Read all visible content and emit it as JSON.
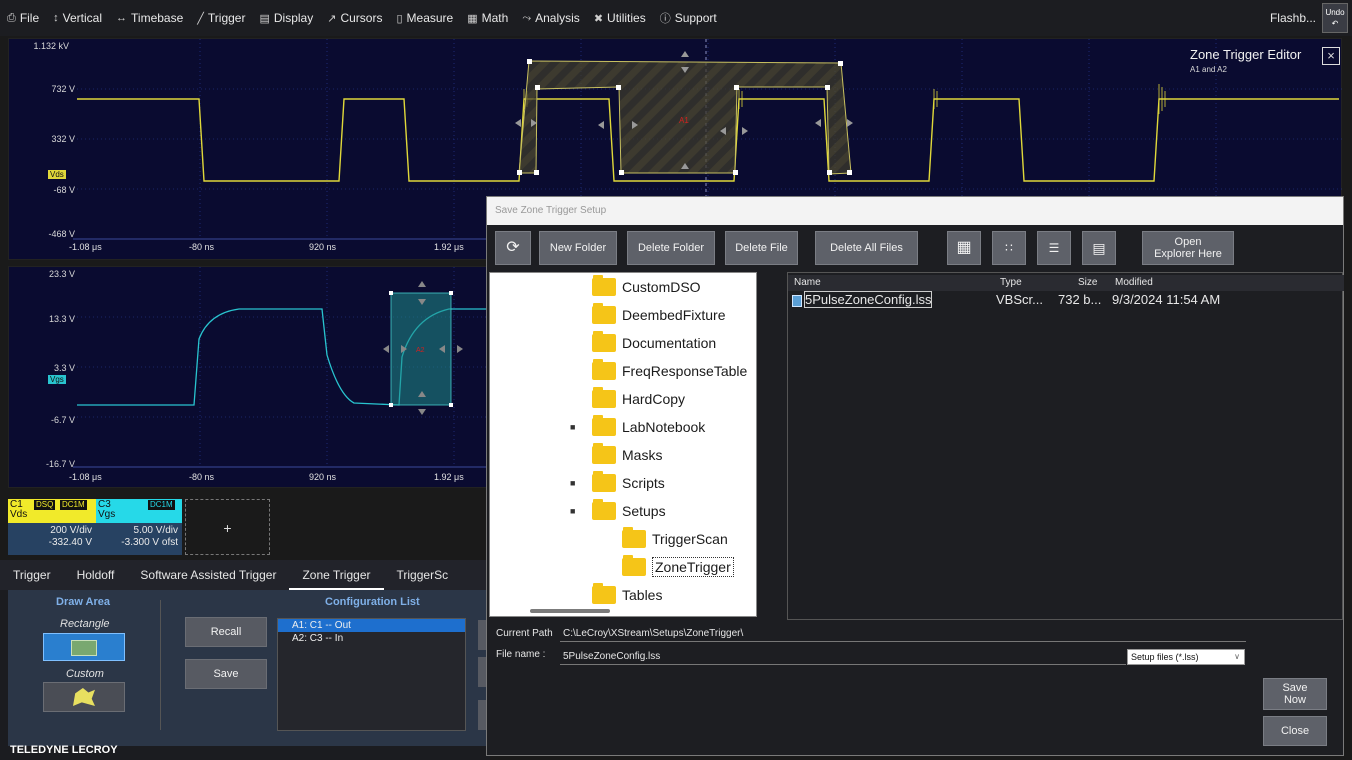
{
  "menu": {
    "items": [
      {
        "icon": "file-icon",
        "glyph": "⎙",
        "label": "File"
      },
      {
        "icon": "vertical-icon",
        "glyph": "↕",
        "label": "Vertical"
      },
      {
        "icon": "timebase-icon",
        "glyph": "↔",
        "label": "Timebase"
      },
      {
        "icon": "trigger-icon",
        "glyph": "╱",
        "label": "Trigger"
      },
      {
        "icon": "display-icon",
        "glyph": "▤",
        "label": "Display"
      },
      {
        "icon": "cursors-icon",
        "glyph": "↗",
        "label": "Cursors"
      },
      {
        "icon": "measure-icon",
        "glyph": "▯",
        "label": "Measure"
      },
      {
        "icon": "math-icon",
        "glyph": "▦",
        "label": "Math"
      },
      {
        "icon": "analysis-icon",
        "glyph": "⤳",
        "label": "Analysis"
      },
      {
        "icon": "utilities-icon",
        "glyph": "✖",
        "label": "Utilities"
      },
      {
        "icon": "support-icon",
        "glyph": "ⓘ",
        "label": "Support"
      }
    ],
    "flashback": "Flashb...",
    "undo": "Undo"
  },
  "grid1": {
    "volts": [
      "1.132 kV",
      "732 V",
      "332 V",
      "-68 V",
      "-468 V"
    ],
    "times": [
      "-1.08 μs",
      "-80 ns",
      "920 ns",
      "1.92 μs"
    ],
    "marker": "Vds",
    "trace_color": "#e0d83a"
  },
  "grid2": {
    "volts": [
      "23.3 V",
      "13.3 V",
      "3.3 V",
      "-6.7 V",
      "-16.7 V"
    ],
    "times": [
      "-1.08 μs",
      "-80 ns",
      "920 ns",
      "1.92 μs"
    ],
    "marker": "Vgs",
    "trace_color": "#29c4cf"
  },
  "zone_editor": {
    "title": "Zone Trigger Editor",
    "subtitle": "A1 and A2",
    "zone1_label": "A1",
    "zone2_label": "A2"
  },
  "channels": [
    {
      "id": "C1",
      "name": "Vds",
      "tag1": "DSQ",
      "tag2": "DC1M",
      "scale": "200 V/div",
      "offset": "-332.40 V",
      "color": "#f1ea2a"
    },
    {
      "id": "C3",
      "name": "Vgs",
      "tag1": "",
      "tag2": "DC1M",
      "scale": "5.00 V/div",
      "offset": "-3.300 V ofst",
      "color": "#26d9e8"
    }
  ],
  "add_channel": "+",
  "trigger_panel": {
    "tabs": [
      "Trigger",
      "Holdoff",
      "Software Assisted Trigger",
      "Zone Trigger",
      "TriggerSc"
    ],
    "active_tab": "Zone Trigger",
    "draw_area_title": "Draw Area",
    "rectangle_label": "Rectangle",
    "custom_label": "Custom",
    "config_title": "Configuration List",
    "recall": "Recall",
    "save": "Save",
    "config_items": [
      "A1: C1 -- Out",
      "A2: C3 -- In"
    ]
  },
  "brand": "TELEDYNE LECROY",
  "dialog": {
    "title": "Save Zone Trigger Setup",
    "toolbar": {
      "new_folder": "New Folder",
      "delete_folder": "Delete Folder",
      "delete_file": "Delete File",
      "delete_all": "Delete All Files",
      "open_explorer_1": "Open",
      "open_explorer_2": "Explorer Here"
    },
    "tree": [
      {
        "label": "CustomDSO",
        "indent": 0,
        "expander": ""
      },
      {
        "label": "DeembedFixture",
        "indent": 0,
        "expander": ""
      },
      {
        "label": "Documentation",
        "indent": 0,
        "expander": ""
      },
      {
        "label": "FreqResponseTable",
        "indent": 0,
        "expander": ""
      },
      {
        "label": "HardCopy",
        "indent": 0,
        "expander": ""
      },
      {
        "label": "LabNotebook",
        "indent": 0,
        "expander": "■"
      },
      {
        "label": "Masks",
        "indent": 0,
        "expander": ""
      },
      {
        "label": "Scripts",
        "indent": 0,
        "expander": "■"
      },
      {
        "label": "Setups",
        "indent": 0,
        "expander": "■"
      },
      {
        "label": "TriggerScan",
        "indent": 1,
        "expander": ""
      },
      {
        "label": "ZoneTrigger",
        "indent": 1,
        "expander": "",
        "selected": true
      },
      {
        "label": "Tables",
        "indent": 0,
        "expander": ""
      }
    ],
    "files_header": {
      "name": "Name",
      "type": "Type",
      "size": "Size",
      "modified": "Modified"
    },
    "files": [
      {
        "name": "5PulseZoneConfig.lss",
        "type": "VBScr...",
        "size": "732 b...",
        "modified": "9/3/2024 11:54 AM"
      }
    ],
    "current_path_label": "Current Path",
    "current_path": "C:\\LeCroy\\XStream\\Setups\\ZoneTrigger\\",
    "file_name_label": "File name :",
    "file_name": "5PulseZoneConfig.lss",
    "file_type": "Setup files (*.lss)",
    "save_now_1": "Save",
    "save_now_2": "Now",
    "close": "Close"
  }
}
